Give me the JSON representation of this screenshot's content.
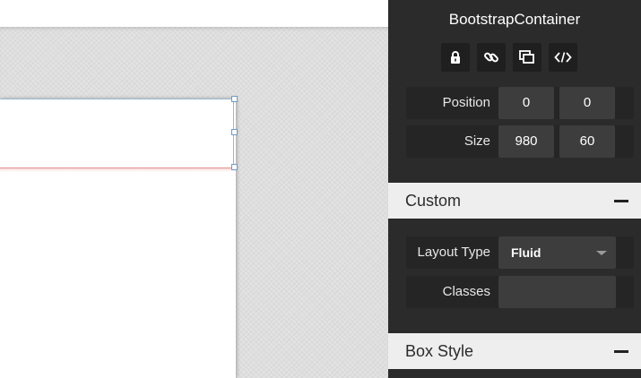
{
  "inspector": {
    "title": "BootstrapContainer",
    "tools": [
      {
        "icon": "lock-icon"
      },
      {
        "icon": "link-icon"
      },
      {
        "icon": "overlap-icon"
      },
      {
        "icon": "code-icon"
      }
    ],
    "position": {
      "label": "Position",
      "x": "0",
      "y": "0"
    },
    "size": {
      "label": "Size",
      "width": "980",
      "height": "60"
    }
  },
  "custom_section": {
    "title": "Custom",
    "layout_type": {
      "label": "Layout Type",
      "value": "Fluid"
    },
    "classes": {
      "label": "Classes",
      "value": ""
    }
  },
  "box_style_section": {
    "title": "Box Style"
  },
  "colors": {
    "panel_bg": "#2b2b2b",
    "field_bg": "#3d3d3d",
    "section_header_bg": "#eeeeee",
    "selection_outline": "#9bb8cf",
    "guide_line": "#e69393"
  }
}
